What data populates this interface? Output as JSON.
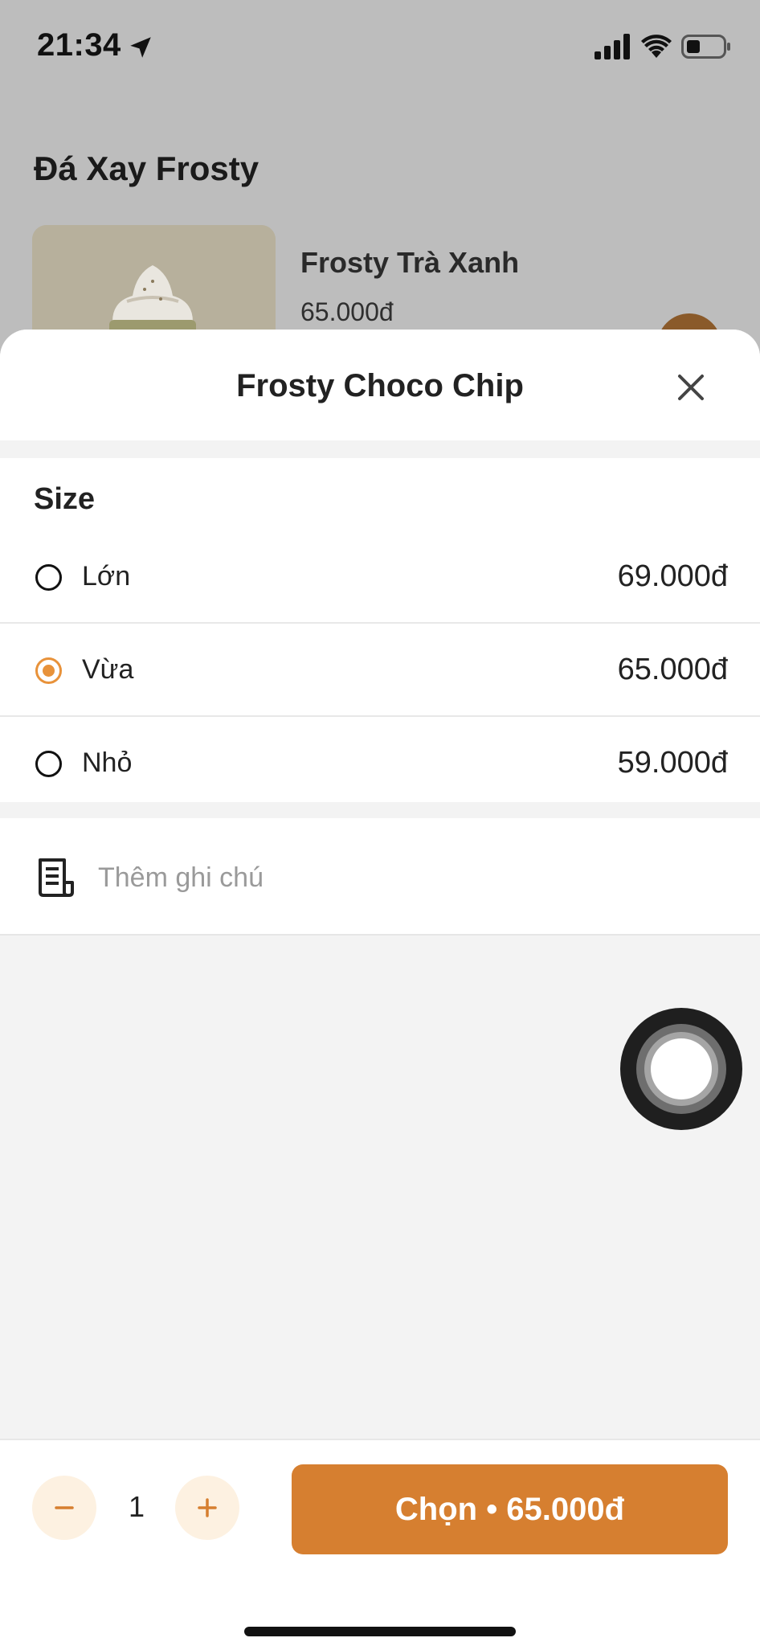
{
  "status_bar": {
    "time": "21:34",
    "icons": [
      "location-arrow-icon",
      "cellular-signal-icon",
      "wifi-icon",
      "battery-icon"
    ]
  },
  "background_page": {
    "section_title": "Đá Xay Frosty",
    "product": {
      "name": "Frosty Trà Xanh",
      "price": "65.000đ"
    }
  },
  "sheet": {
    "title": "Frosty Choco Chip",
    "size": {
      "title": "Size",
      "options": [
        {
          "label": "Lớn",
          "price": "69.000đ",
          "selected": false
        },
        {
          "label": "Vừa",
          "price": "65.000đ",
          "selected": true
        },
        {
          "label": "Nhỏ",
          "price": "59.000đ",
          "selected": false
        }
      ]
    },
    "note": {
      "placeholder": "Thêm ghi chú",
      "value": ""
    }
  },
  "bottom_bar": {
    "quantity": "1",
    "choose_label": "Chọn • 65.000đ"
  },
  "colors": {
    "accent": "#D67F30",
    "radio_selected": "#E8923A",
    "qty_button_bg": "#FDF1E1"
  }
}
